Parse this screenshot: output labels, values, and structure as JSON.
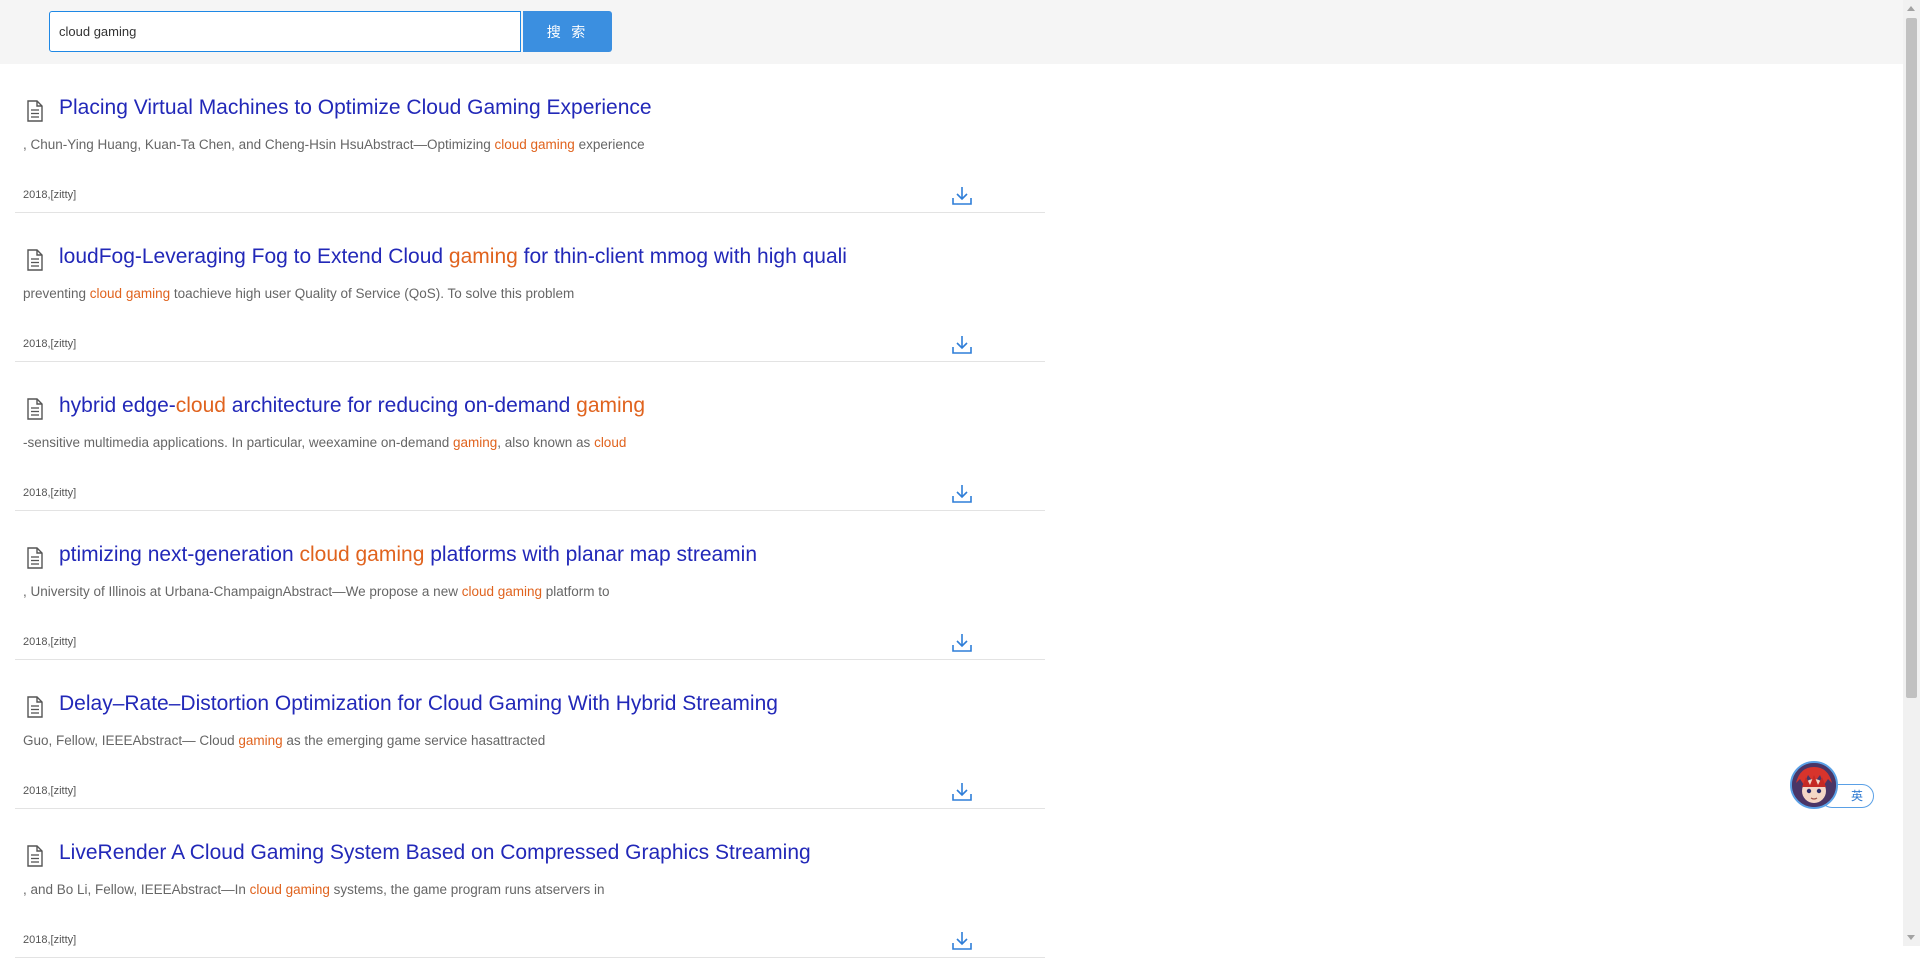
{
  "search": {
    "value": "cloud gaming",
    "button_label": "搜 索"
  },
  "results": [
    {
      "title_parts": [
        {
          "text": "Placing Virtual Machines to Optimize Cloud Gaming Experience",
          "hl": false
        }
      ],
      "snippet_parts": [
        {
          "text": ", Chun-Ying Huang, Kuan-Ta Chen, and Cheng-Hsin HsuAbstract—Optimizing ",
          "hl": false
        },
        {
          "text": "cloud gaming",
          "hl": true
        },
        {
          "text": " experience",
          "hl": false
        }
      ],
      "meta": "2018,[zitty]"
    },
    {
      "title_parts": [
        {
          "text": "loudFog-Leveraging Fog to Extend Cloud ",
          "hl": false
        },
        {
          "text": "gaming",
          "hl": true
        },
        {
          "text": " for thin-client mmog with high quali",
          "hl": false
        }
      ],
      "snippet_parts": [
        {
          "text": "preventing ",
          "hl": false
        },
        {
          "text": "cloud gaming",
          "hl": true
        },
        {
          "text": " toachieve high user Quality of Service (QoS). To solve this problem",
          "hl": false
        }
      ],
      "meta": "2018,[zitty]"
    },
    {
      "title_parts": [
        {
          "text": " hybrid edge-",
          "hl": false
        },
        {
          "text": "cloud",
          "hl": true
        },
        {
          "text": " architecture for reducing on-demand ",
          "hl": false
        },
        {
          "text": "gaming",
          "hl": true
        }
      ],
      "snippet_parts": [
        {
          "text": "-sensitive multimedia applications. In particular, weexamine on-demand ",
          "hl": false
        },
        {
          "text": "gaming",
          "hl": true
        },
        {
          "text": ", also known as ",
          "hl": false
        },
        {
          "text": "cloud",
          "hl": true
        }
      ],
      "meta": "2018,[zitty]"
    },
    {
      "title_parts": [
        {
          "text": "ptimizing next-generation ",
          "hl": false
        },
        {
          "text": "cloud gaming",
          "hl": true
        },
        {
          "text": " platforms with planar map streamin",
          "hl": false
        }
      ],
      "snippet_parts": [
        {
          "text": ", University of Illinois at Urbana-ChampaignAbstract—We propose a new ",
          "hl": false
        },
        {
          "text": "cloud gaming",
          "hl": true
        },
        {
          "text": " platform to",
          "hl": false
        }
      ],
      "meta": "2018,[zitty]"
    },
    {
      "title_parts": [
        {
          "text": "Delay–Rate–Distortion Optimization for Cloud Gaming With Hybrid Streaming",
          "hl": false
        }
      ],
      "snippet_parts": [
        {
          "text": "Guo, Fellow, IEEEAbstract— Cloud ",
          "hl": false
        },
        {
          "text": "gaming",
          "hl": true
        },
        {
          "text": " as the emerging game service hasattracted",
          "hl": false
        }
      ],
      "meta": "2018,[zitty]"
    },
    {
      "title_parts": [
        {
          "text": "LiveRender A Cloud Gaming System Based on Compressed Graphics Streaming",
          "hl": false
        }
      ],
      "snippet_parts": [
        {
          "text": ", and Bo Li, Fellow, IEEEAbstract—In ",
          "hl": false
        },
        {
          "text": "cloud gaming",
          "hl": true
        },
        {
          "text": " systems, the game program runs atservers in",
          "hl": false
        }
      ],
      "meta": "2018,[zitty]"
    }
  ],
  "icons": {
    "result_type": "document-icon",
    "download": "download-icon"
  },
  "assistant": {
    "lang_label": "英"
  },
  "colors": {
    "title": "#2228b8",
    "highlight": "#e0631e",
    "accent": "#3b8fe0"
  }
}
